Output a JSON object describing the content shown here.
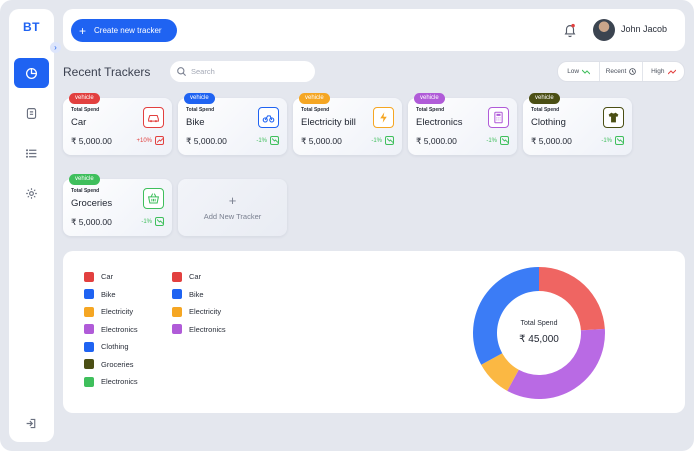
{
  "app": {
    "logo": "BT",
    "accent": "#1f63f2"
  },
  "sidebar": {
    "items": [
      {
        "icon": "pie-chart-icon",
        "active": true
      },
      {
        "icon": "receipt-icon",
        "active": false
      },
      {
        "icon": "list-icon",
        "active": false
      },
      {
        "icon": "gear-icon",
        "active": false
      }
    ],
    "logout_icon": "logout-icon"
  },
  "topbar": {
    "create_label": "Create new tracker",
    "user_name": "John Jacob"
  },
  "trackers": {
    "title": "Recent Trackers",
    "search_placeholder": "Search",
    "filters": [
      "Low",
      "Recent",
      "High"
    ],
    "total_spend_label": "Total Spend",
    "cards": [
      {
        "badge": "vehicle",
        "badge_color": "#e2403f",
        "name": "Car",
        "amount": "₹ 5,000.00",
        "change": "+10%",
        "trend": "up",
        "icon": "car-icon",
        "icon_color": "#e2403f"
      },
      {
        "badge": "vehicle",
        "badge_color": "#1f63f2",
        "name": "Bike",
        "amount": "₹ 5,000.00",
        "change": "-1%",
        "trend": "down",
        "icon": "motorbike-icon",
        "icon_color": "#1f63f2"
      },
      {
        "badge": "vehicle",
        "badge_color": "#f5a623",
        "name": "Electricity bill",
        "amount": "₹ 5,000.00",
        "change": "-1%",
        "trend": "down",
        "icon": "lightning-icon",
        "icon_color": "#f5a623"
      },
      {
        "badge": "vehicle",
        "badge_color": "#b05bd8",
        "name": "Electronics",
        "amount": "₹ 5,000.00",
        "change": "-1%",
        "trend": "down",
        "icon": "calculator-icon",
        "icon_color": "#b05bd8"
      },
      {
        "badge": "vehicle",
        "badge_color": "#4b4f14",
        "name": "Clothing",
        "amount": "₹ 5,000.00",
        "change": "-1%",
        "trend": "down",
        "icon": "shirt-icon",
        "icon_color": "#4b4f14"
      },
      {
        "badge": "vehicle",
        "badge_color": "#3fbf5c",
        "name": "Groceries",
        "amount": "₹ 5,000.00",
        "change": "-1%",
        "trend": "down",
        "icon": "basket-icon",
        "icon_color": "#3fbf5c"
      }
    ],
    "add_label": "Add New Tracker",
    "add_plus": "+"
  },
  "summary": {
    "legend_left": [
      {
        "label": "Car",
        "color": "#e2403f"
      },
      {
        "label": "Bike",
        "color": "#1f63f2"
      },
      {
        "label": "Electricity",
        "color": "#f5a623"
      },
      {
        "label": "Electronics",
        "color": "#b05bd8"
      },
      {
        "label": "Clothing",
        "color": "#1f63f2"
      },
      {
        "label": "Groceries",
        "color": "#4b4f14"
      },
      {
        "label": "Electronics",
        "color": "#3fbf5c"
      }
    ],
    "legend_right": [
      {
        "label": "Car",
        "color": "#e2403f"
      },
      {
        "label": "Bike",
        "color": "#1f63f2"
      },
      {
        "label": "Electricity",
        "color": "#f5a623"
      },
      {
        "label": "Electronics",
        "color": "#b05bd8"
      }
    ],
    "donut_label": "Total Spend",
    "donut_value": "₹ 45,000"
  },
  "chart_data": {
    "type": "pie",
    "title": "",
    "categories": [
      "Car",
      "Electronics",
      "Electricity",
      "Bike"
    ],
    "values": [
      24,
      34,
      9,
      33
    ],
    "colors": [
      "#ef6562",
      "#b96ae4",
      "#fbb843",
      "#3b7cf6"
    ],
    "donut": true
  }
}
